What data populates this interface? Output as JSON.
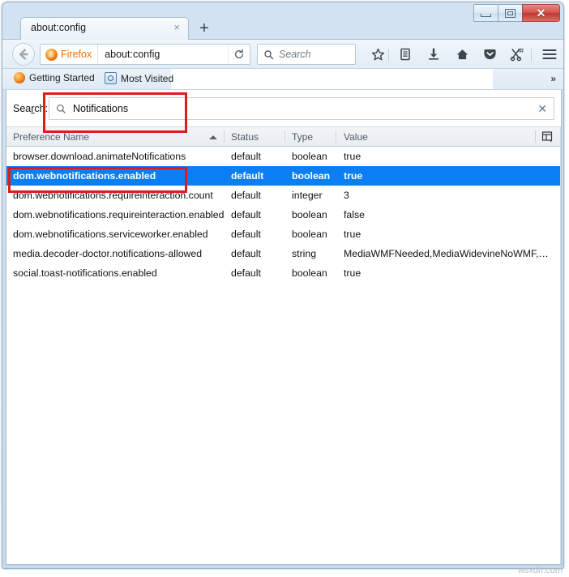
{
  "window": {
    "controls": {
      "minimize": "Minimize",
      "maximize": "Restore",
      "close": "✕"
    }
  },
  "tabs": {
    "active": {
      "title": "about:config",
      "close_label": "×"
    },
    "new_tab_label": "+"
  },
  "navbar": {
    "back_label": "Back",
    "identity_label": "Firefox",
    "url": "about:config",
    "reload_label": "Reload",
    "search_placeholder": "Search",
    "icons": [
      "star-icon",
      "library-icon",
      "downloads-icon",
      "home-icon",
      "pocket-icon",
      "screenshot-icon",
      "menu-icon"
    ]
  },
  "bookmarks": {
    "items": [
      {
        "label": "Getting Started",
        "icon": "firefox-icon"
      },
      {
        "label": "Most Visited",
        "icon": "most-visited-icon"
      }
    ],
    "overflow_label": "»"
  },
  "config": {
    "search_label_pre": "Sea",
    "search_label_key": "r",
    "search_label_post": "ch:",
    "search_value": "Notifications",
    "search_clear_label": "✕",
    "columns": [
      {
        "key": "name",
        "label": "Preference Name",
        "sorted": "asc"
      },
      {
        "key": "status",
        "label": "Status"
      },
      {
        "key": "type",
        "label": "Type"
      },
      {
        "key": "value",
        "label": "Value"
      }
    ],
    "rows": [
      {
        "name": "browser.download.animateNotifications",
        "status": "default",
        "type": "boolean",
        "value": "true",
        "selected": false
      },
      {
        "name": "dom.webnotifications.enabled",
        "status": "default",
        "type": "boolean",
        "value": "true",
        "selected": true
      },
      {
        "name": "dom.webnotifications.requireinteraction.count",
        "status": "default",
        "type": "integer",
        "value": "3",
        "selected": false
      },
      {
        "name": "dom.webnotifications.requireinteraction.enabled",
        "status": "default",
        "type": "boolean",
        "value": "false",
        "selected": false
      },
      {
        "name": "dom.webnotifications.serviceworker.enabled",
        "status": "default",
        "type": "boolean",
        "value": "true",
        "selected": false
      },
      {
        "name": "media.decoder-doctor.notifications-allowed",
        "status": "default",
        "type": "string",
        "value": "MediaWMFNeeded,MediaWidevineNoWMF,Media…",
        "selected": false
      },
      {
        "name": "social.toast-notifications.enabled",
        "status": "default",
        "type": "boolean",
        "value": "true",
        "selected": false
      }
    ]
  },
  "annotations": {
    "highlight_color": "#e01b1b",
    "boxes": [
      {
        "target": "prefs-search-box"
      },
      {
        "target": "selected-row"
      }
    ]
  },
  "watermark": "wsxdn.com",
  "colors": {
    "selection_blue": "#0b7ef4",
    "firefox_orange": "#e8720c",
    "annotation_red": "#e01b1b"
  }
}
